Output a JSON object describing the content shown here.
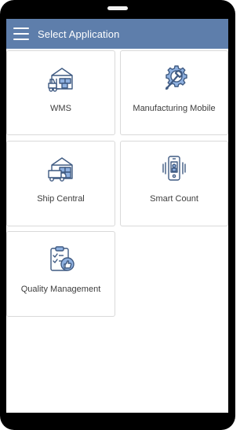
{
  "header": {
    "title": "Select Application",
    "menu_icon": "hamburger-menu-icon",
    "background": "#5e7eab"
  },
  "apps": [
    {
      "label": "WMS",
      "icon": "warehouse-forklift-icon"
    },
    {
      "label": "Manufacturing Mobile",
      "icon": "wrench-gear-icon"
    },
    {
      "label": "Ship Central",
      "icon": "warehouse-truck-icon"
    },
    {
      "label": "Smart Count",
      "icon": "phone-scan-icon"
    },
    {
      "label": "Quality Management",
      "icon": "clipboard-thumbs-up-icon"
    }
  ],
  "colors": {
    "icon_stroke": "#3f5a82",
    "icon_accent": "#8fb1e0",
    "label": "#3d3d3d"
  }
}
